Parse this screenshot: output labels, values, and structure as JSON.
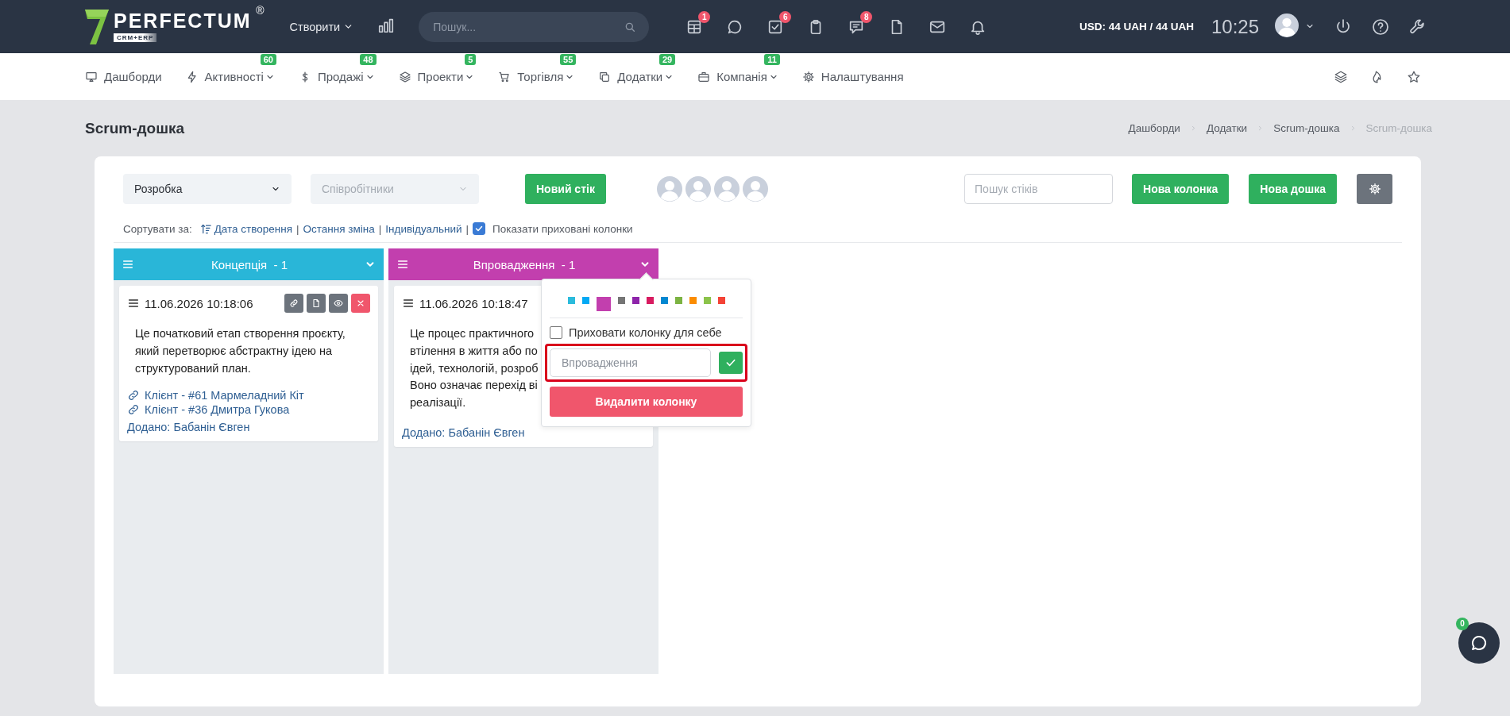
{
  "topbar": {
    "logo": {
      "name": "PERFECTUM",
      "mark": "®",
      "tagline": "CRM+ERP"
    },
    "create_menu": "Створити",
    "search": {
      "placeholder": "Пошук..."
    },
    "icons": [
      {
        "kind": "calendar",
        "badge": "1"
      },
      {
        "kind": "chat"
      },
      {
        "kind": "tasks",
        "badge": "6"
      },
      {
        "kind": "clipboard"
      },
      {
        "kind": "messages",
        "badge": "8"
      },
      {
        "kind": "file"
      },
      {
        "kind": "mail"
      },
      {
        "kind": "bell"
      }
    ],
    "currency": "USD: 44 UAH / 44 UAH",
    "time": "10:25",
    "actions": [
      {
        "kind": "power"
      },
      {
        "kind": "help"
      },
      {
        "kind": "wrench"
      }
    ]
  },
  "nav": {
    "items": [
      {
        "kind": "monitor",
        "label": "Дашборди",
        "dropdown": false
      },
      {
        "kind": "bolt",
        "label": "Активності",
        "badge": "60",
        "dropdown": true
      },
      {
        "kind": "dollar",
        "label": "Продажі",
        "badge": "48",
        "dropdown": true
      },
      {
        "kind": "layers",
        "label": "Проекти",
        "badge": "5",
        "dropdown": true
      },
      {
        "kind": "cart",
        "label": "Торгівля",
        "badge": "55",
        "dropdown": true
      },
      {
        "kind": "copy",
        "label": "Додатки",
        "badge": "29",
        "dropdown": true
      },
      {
        "kind": "briefcase",
        "label": "Компанія",
        "badge": "11",
        "dropdown": true
      },
      {
        "kind": "gear",
        "label": "Налаштування",
        "dropdown": false
      }
    ],
    "tools": [
      {
        "kind": "layers"
      },
      {
        "kind": "flame"
      },
      {
        "kind": "star"
      }
    ]
  },
  "page": {
    "title": "Scrum-дошка",
    "breadcrumb": [
      {
        "label": "Дашборди",
        "current": false
      },
      {
        "label": "Додатки",
        "current": false
      },
      {
        "label": "Scrum-дошка",
        "current": false
      },
      {
        "label": "Scrum-дошка",
        "current": true
      }
    ]
  },
  "board": {
    "project_select": {
      "value": "Розробка"
    },
    "employee_select": {
      "placeholder": "Співробітники"
    },
    "new_stick": "Новий стік",
    "avatars": [
      {
        "kind": "silhouette"
      },
      {
        "kind": "silhouette"
      },
      {
        "kind": "silhouette"
      },
      {
        "kind": "silhouette"
      }
    ],
    "search": {
      "placeholder": "Пошук стіків"
    },
    "buttons": [
      {
        "kind": "primary",
        "label": "Нова колонка"
      },
      {
        "kind": "primary",
        "label": "Нова дошка"
      },
      {
        "kind": "settings"
      }
    ],
    "sort": {
      "label": "Сортувати за:",
      "options": [
        {
          "label": "Дата створення",
          "active": true,
          "separator": "|"
        },
        {
          "label": "Остання зміна",
          "active": false,
          "separator": "|"
        },
        {
          "label": "Індивідуальний",
          "active": false,
          "separator": "|"
        }
      ],
      "show_hidden": {
        "label": "Показати приховані колонки",
        "checked": true
      }
    },
    "columns": [
      {
        "title": "Концепція",
        "count": "- 1",
        "color": "#29b6d8",
        "cards": [
          {
            "date": "11.06.2026 10:18:06",
            "actions": [
              {
                "kind": "link"
              },
              {
                "kind": "file"
              },
              {
                "kind": "view"
              },
              {
                "kind": "delete"
              }
            ],
            "text": "Це початковий етап створення проєкту,\nякий перетворює абстрактну ідею на\nструктурований план.",
            "links": [
              "Клієнт - #61 Мармеладний Кіт",
              "Клієнт - #36 Дмитра Гукова"
            ],
            "added_by": "Додано: Бабанін Євген"
          }
        ]
      },
      {
        "title": "Впровадження",
        "count": "- 1",
        "color": "#c23fae",
        "cards": [
          {
            "date": "11.06.2026 10:18:47",
            "text": "Це процес практичного\nвтілення в життя або по\nідей, технологій, розроб\nВоно означає перехід ві\nреалізації.",
            "added_by": "Додано: Бабанін Євген"
          }
        ],
        "menu": {
          "colors": [
            {
              "color": "#2bbbdc",
              "selected": false
            },
            {
              "color": "#03a9f4",
              "selected": false
            },
            {
              "color": "#c23fae",
              "selected": true
            },
            {
              "color": "#757575",
              "selected": false
            },
            {
              "color": "#8e24aa",
              "selected": false
            },
            {
              "color": "#d81b60",
              "selected": false
            },
            {
              "color": "#0288d1",
              "selected": false
            },
            {
              "color": "#7cb342",
              "selected": false
            },
            {
              "color": "#fb8c00",
              "selected": false
            },
            {
              "color": "#8bc34a",
              "selected": false
            },
            {
              "color": "#f44336",
              "selected": false
            }
          ],
          "hide_checkbox": {
            "label": "Приховати колонку для себе",
            "checked": false
          },
          "name_field": {
            "placeholder": "Впровадження",
            "highlighted": true
          },
          "delete_button": "Видалити колонку"
        }
      }
    ]
  },
  "chat": {
    "badge": "0"
  }
}
